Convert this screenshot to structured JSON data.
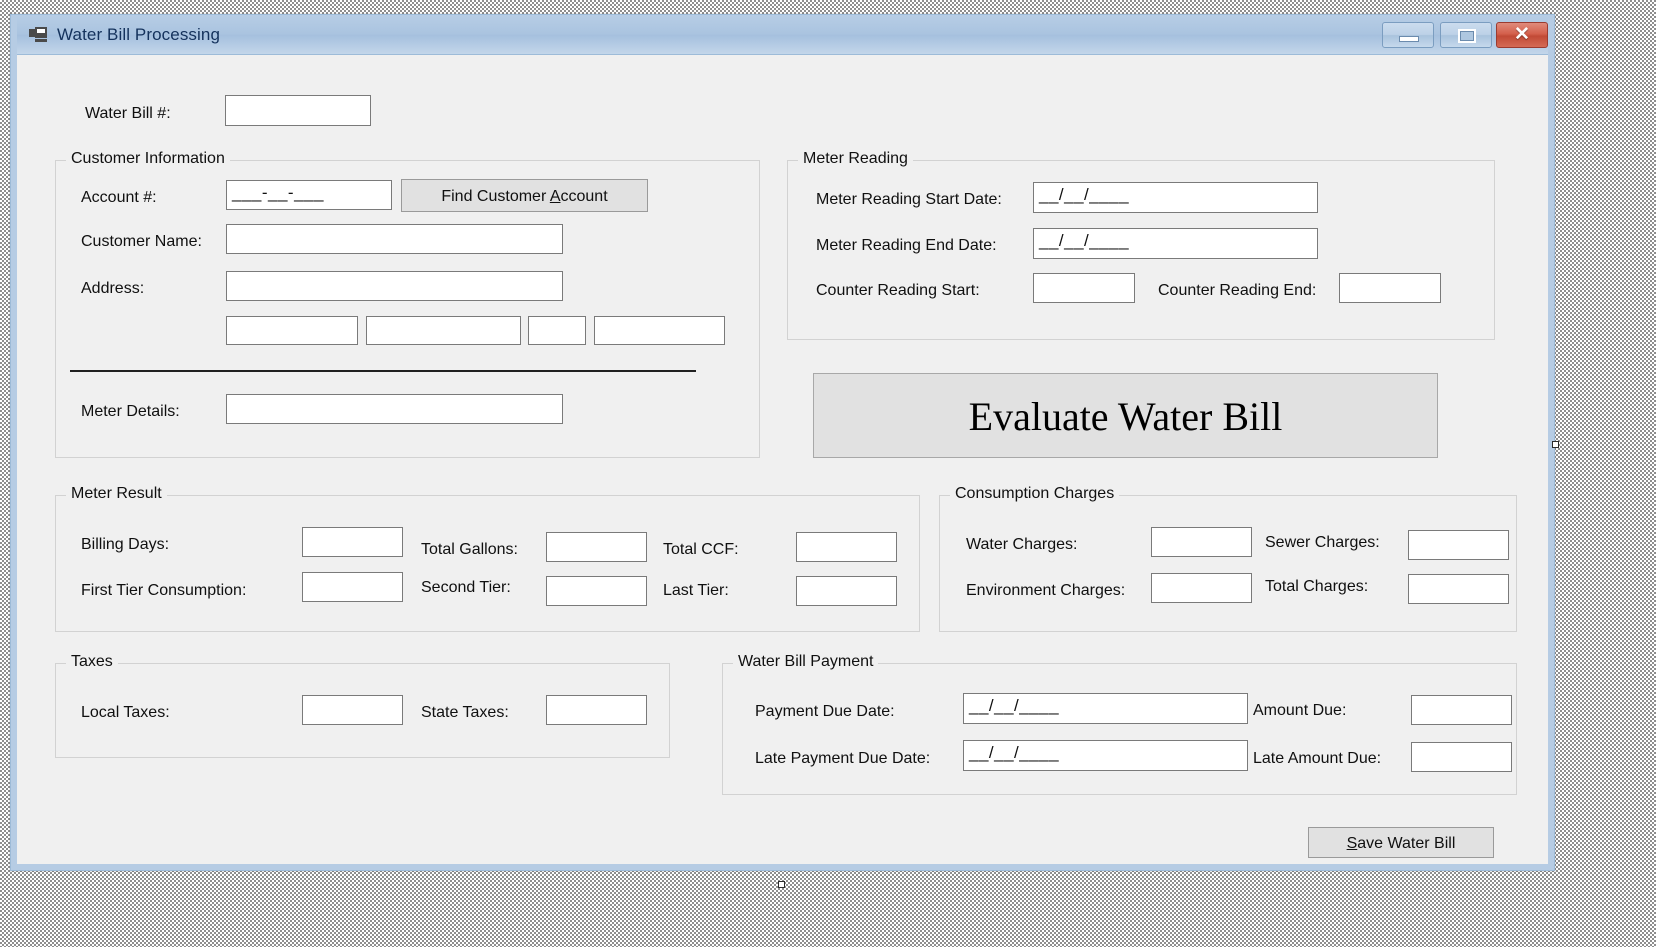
{
  "window": {
    "title": "Water Bill Processing",
    "icon": "form-icon",
    "controls": {
      "minimize": "minimize-icon",
      "maximize": "maximize-icon",
      "close": "close-icon"
    },
    "colors": {
      "titlebar_start": "#b7cde5",
      "titlebar_end": "#c3d6ea",
      "close_button": "#c14a36",
      "client_background": "#f0f0f0",
      "border": "#b6cce4"
    }
  },
  "top": {
    "water_bill_label": "Water Bill #:",
    "water_bill_value": "",
    "water_bill_placeholder": ""
  },
  "customer_information": {
    "title": "Customer Information",
    "account_label": "Account #:",
    "account_mask": "___-__-___",
    "find_button": {
      "prefix": "Find Customer ",
      "accel": "A",
      "suffix": "ccount"
    },
    "customer_name_label": "Customer Name:",
    "customer_name_value": "",
    "address_label": "Address:",
    "address_value": "",
    "address_city_value": "",
    "address_line2_value": "",
    "address_state_value": "",
    "address_zip_value": "",
    "meter_details_label": "Meter Details:",
    "meter_details_value": ""
  },
  "meter_reading": {
    "title": "Meter Reading",
    "start_date_label": "Meter Reading Start Date:",
    "start_date_mask": "__/__/____",
    "end_date_label": "Meter Reading End Date:",
    "end_date_mask": "__/__/____",
    "counter_start_label": "Counter Reading Start:",
    "counter_start_value": "",
    "counter_end_label": "Counter Reading End:",
    "counter_end_value": ""
  },
  "evaluate_button": "Evaluate Water Bill",
  "meter_result": {
    "title": "Meter Result",
    "billing_days_label": "Billing Days:",
    "billing_days_value": "",
    "total_gallons_label": "Total Gallons:",
    "total_gallons_value": "",
    "total_ccf_label": "Total CCF:",
    "total_ccf_value": "",
    "first_tier_label": "First Tier Consumption:",
    "first_tier_value": "",
    "second_tier_label": "Second Tier:",
    "second_tier_value": "",
    "last_tier_label": "Last Tier:",
    "last_tier_value": ""
  },
  "consumption_charges": {
    "title": "Consumption Charges",
    "water_charges_label": "Water Charges:",
    "water_charges_value": "",
    "sewer_charges_label": "Sewer Charges:",
    "sewer_charges_value": "",
    "environment_charges_label": "Environment Charges:",
    "environment_charges_value": "",
    "total_charges_label": "Total Charges:",
    "total_charges_value": ""
  },
  "taxes": {
    "title": "Taxes",
    "local_taxes_label": "Local Taxes:",
    "local_taxes_value": "",
    "state_taxes_label": "State Taxes:",
    "state_taxes_value": ""
  },
  "water_bill_payment": {
    "title": "Water Bill Payment",
    "payment_due_label": "Payment Due Date:",
    "payment_due_mask": "__/__/____",
    "amount_due_label": "Amount Due:",
    "amount_due_value": "",
    "late_payment_due_label": "Late Payment Due Date:",
    "late_payment_due_mask": "__/__/____",
    "late_amount_due_label": "Late Amount Due:",
    "late_amount_due_value": ""
  },
  "save_button": {
    "accel": "S",
    "suffix": "ave Water Bill"
  }
}
